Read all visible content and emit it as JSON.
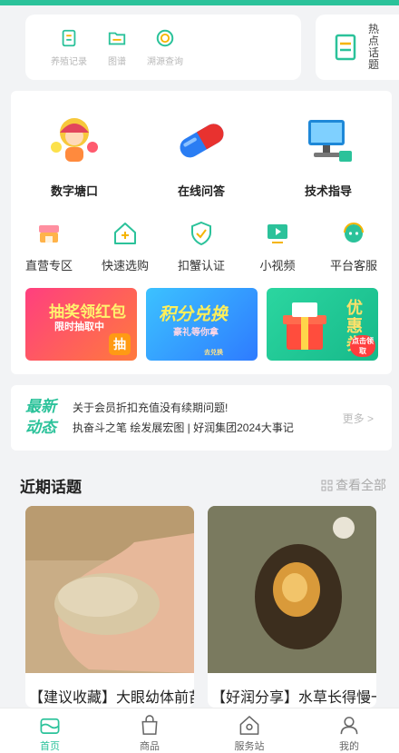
{
  "quick_links": [
    {
      "label": "养殖记录",
      "icon": "clipboard-icon"
    },
    {
      "label": "图谱",
      "icon": "folder-icon"
    },
    {
      "label": "溯源查询",
      "icon": "trace-icon"
    }
  ],
  "hot_topics": {
    "label": "热点话题",
    "icon": "document-icon"
  },
  "big_features": [
    {
      "label": "数字塘口",
      "icon": "digital-pond-illustration"
    },
    {
      "label": "在线问答",
      "icon": "capsule-illustration"
    },
    {
      "label": "技术指导",
      "icon": "computer-illustration"
    }
  ],
  "small_features": [
    {
      "label": "直营专区",
      "icon": "store-icon"
    },
    {
      "label": "快速选购",
      "icon": "house-plus-icon"
    },
    {
      "label": "扣蟹认证",
      "icon": "shield-check-icon"
    },
    {
      "label": "小视频",
      "icon": "video-icon"
    },
    {
      "label": "平台客服",
      "icon": "headset-icon"
    }
  ],
  "banners": [
    {
      "title": "抽奖领红包",
      "subtitle": "限时抽取中",
      "badge": "抽"
    },
    {
      "title": "积分兑换",
      "subtitle": "豪礼等你拿",
      "badge": "去兑换"
    },
    {
      "title": "优惠券",
      "badge": "点击领取"
    }
  ],
  "news": {
    "tag_line1": "最新",
    "tag_line2": "动态",
    "items": [
      "关于会员折扣充值没有续期问题!",
      "执奋斗之笔 绘发展宏图 | 好润集团2024大事记"
    ],
    "more": "更多 >"
  },
  "recent": {
    "title": "近期话题",
    "view_all": "查看全部",
    "posts": [
      {
        "title": "【建议收藏】大眼幼体前苗操程大解阅"
      },
      {
        "title": "【好润分享】水草长得慢一点也好"
      }
    ]
  },
  "tabs": [
    {
      "label": "首页",
      "icon": "home-icon",
      "active": true
    },
    {
      "label": "商品",
      "icon": "shopping-bag-icon",
      "active": false
    },
    {
      "label": "服务站",
      "icon": "service-station-icon",
      "active": false
    },
    {
      "label": "我的",
      "icon": "user-icon",
      "active": false
    }
  ],
  "colors": {
    "accent": "#2bc29a",
    "background": "#f2f3f5"
  }
}
